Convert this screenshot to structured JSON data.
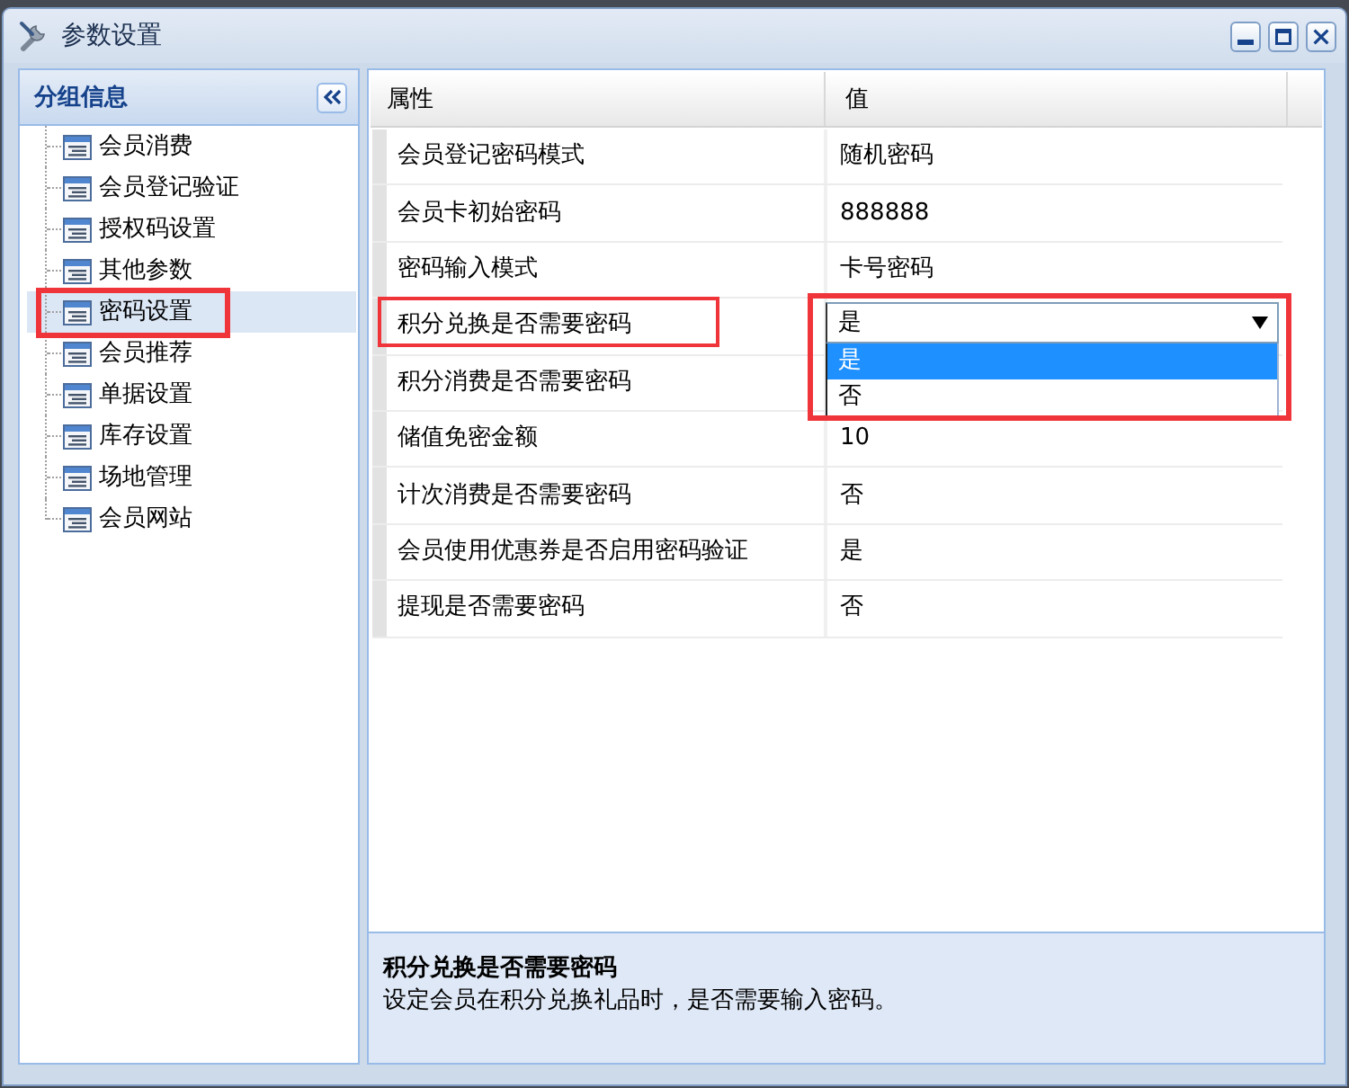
{
  "window": {
    "title": "参数设置"
  },
  "sidebar": {
    "title": "分组信息",
    "items": [
      {
        "label": "会员消费",
        "selected": false,
        "annotated": false
      },
      {
        "label": "会员登记验证",
        "selected": false,
        "annotated": false
      },
      {
        "label": "授权码设置",
        "selected": false,
        "annotated": false
      },
      {
        "label": "其他参数",
        "selected": false,
        "annotated": false
      },
      {
        "label": "密码设置",
        "selected": true,
        "annotated": true
      },
      {
        "label": "会员推荐",
        "selected": false,
        "annotated": false
      },
      {
        "label": "单据设置",
        "selected": false,
        "annotated": false
      },
      {
        "label": "库存设置",
        "selected": false,
        "annotated": false
      },
      {
        "label": "场地管理",
        "selected": false,
        "annotated": false
      },
      {
        "label": "会员网站",
        "selected": false,
        "annotated": false
      }
    ]
  },
  "property_grid": {
    "columns": [
      "属性",
      "值"
    ],
    "rows": [
      {
        "kind": "text",
        "name": "会员登记密码模式",
        "value": "随机密码",
        "annotated": false
      },
      {
        "kind": "text",
        "name": "会员卡初始密码",
        "value": "888888",
        "annotated": false
      },
      {
        "kind": "text",
        "name": "密码输入模式",
        "value": "卡号密码",
        "annotated": false
      },
      {
        "kind": "dropdown",
        "name": "积分兑换是否需要密码",
        "value": "是",
        "annotated": true,
        "dropdown": {
          "expanded": true,
          "annotated": true,
          "options": [
            {
              "label": "是",
              "selected": true
            },
            {
              "label": "否",
              "selected": false
            }
          ]
        }
      },
      {
        "kind": "text",
        "name": "积分消费是否需要密码",
        "annotated": false
      },
      {
        "kind": "text",
        "name": "储值免密金额",
        "value": "10",
        "annotated": false
      },
      {
        "kind": "text",
        "name": "计次消费是否需要密码",
        "value": "否",
        "annotated": false
      },
      {
        "kind": "text",
        "name": "会员使用优惠券是否启用密码验证",
        "value": "是",
        "annotated": false
      },
      {
        "kind": "text",
        "name": "提现是否需要密码",
        "value": "否",
        "annotated": false
      }
    ]
  },
  "description": {
    "title": "积分兑换是否需要密码",
    "text": "设定会员在积分兑换礼品时，是否需要输入密码。"
  }
}
